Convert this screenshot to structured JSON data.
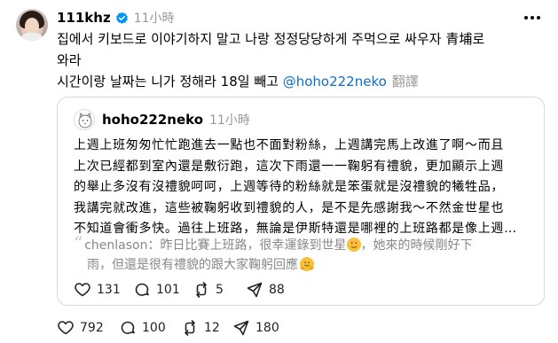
{
  "post": {
    "author": "111khz",
    "verified": true,
    "time": "11小時",
    "text_lines": [
      "집에서 키보드로 이야기하지 말고 나랑 정정당당하게 주먹으로 싸우자 青埔로",
      "와라",
      "시간이랑 날짜는 니가 정해라 18일 빼고"
    ],
    "mention": "@hoho222neko",
    "translate_label": "翻譯",
    "stats": {
      "likes": "792",
      "replies": "100",
      "reposts": "12",
      "shares": "180"
    }
  },
  "quote": {
    "author": "hoho222neko",
    "time": "11小時",
    "text_lines": [
      "上週上班匆匆忙忙跑進去一點也不面對粉絲，上週講完馬上改進了啊～而且",
      "上次已經都到室內還是敷衍跑，這次下雨還一一鞠躬有禮貌，更加顯示上週",
      "的舉止多沒有沒禮貌呵呵，上週等待的粉絲就是笨蛋就是沒禮貌的犧牲品，",
      "我講完就改進，這些被鞠躬收到禮貌的人，是不是先感謝我～不然金世星也",
      "不知道會衝多快。過往上班路，無論是伊斯特還是哪裡的上班路都是像上週…"
    ],
    "reply": {
      "author": "chenlason",
      "line1_before_emoji": "昨日比賽上班路，很幸運錄到世星",
      "line1_after_emoji": "，她來的時候剛好下",
      "line2": "雨，但還是很有禮貌的跟大家鞠躬回應"
    },
    "stats": {
      "likes": "131",
      "replies": "101",
      "reposts": "5",
      "shares": "88"
    }
  },
  "icons": {
    "verified": "verified-badge-icon",
    "like": "heart-icon",
    "reply": "comment-icon",
    "repost": "repost-icon",
    "share": "share-icon",
    "more": "more-dots-icon"
  },
  "colors": {
    "verified": "#0095f6",
    "mention": "#0f6ec8",
    "muted": "#999999"
  }
}
